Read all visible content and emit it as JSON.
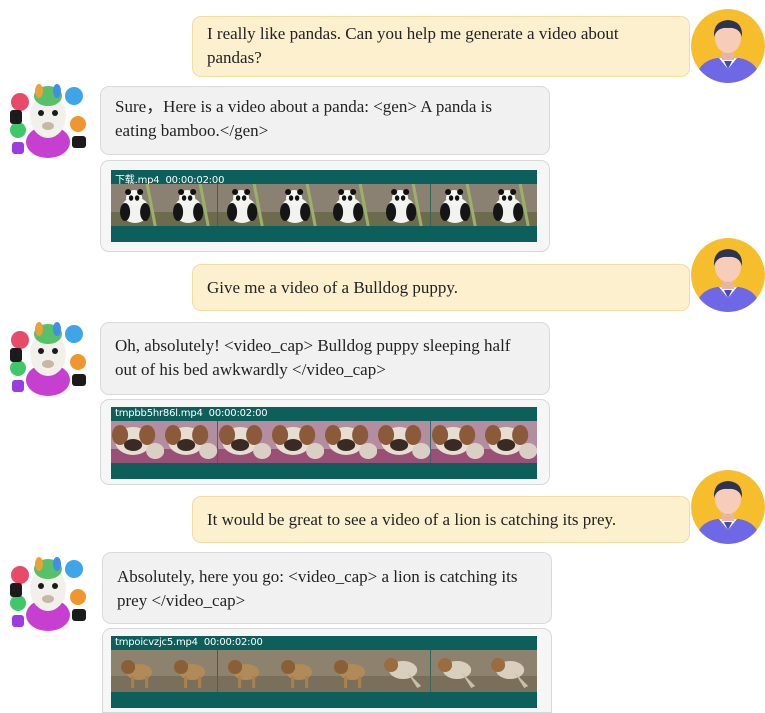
{
  "conversation": [
    {
      "role": "user",
      "text": "I really like pandas. Can you help me generate a video about pandas?"
    },
    {
      "role": "assistant",
      "text": "Sure，Here is  a video about a panda: <gen> A panda is eating bamboo.</gen>",
      "video": {
        "filename": "下载.mp4",
        "timestamp": "00:00:02:00",
        "subject": "panda"
      }
    },
    {
      "role": "user",
      "text": "Give me a video of a Bulldog puppy."
    },
    {
      "role": "assistant",
      "text": "Oh, absolutely!  <video_cap> Bulldog puppy sleeping half out of his bed awkwardly </video_cap>",
      "video": {
        "filename": "tmpbb5hr86l.mp4",
        "timestamp": "00:00:02:00",
        "subject": "bulldog puppy"
      }
    },
    {
      "role": "user",
      "text": "It would be great to see a video of a lion is catching its prey."
    },
    {
      "role": "assistant",
      "text": "Absolutely, here you go: <video_cap> a lion is catching its prey </video_cap>",
      "video": {
        "filename": "tmpoicvzjc5.mp4",
        "timestamp": "00:00:02:00",
        "subject": "lion"
      }
    }
  ],
  "icons": {
    "user_avatar": "user-avatar-icon",
    "assistant_avatar": "rainbow-alpaca-icon"
  },
  "colors": {
    "user_bubble": "#fcf0cf",
    "user_border": "#f3dc9f",
    "assistant_bubble": "#f1f1f1",
    "assistant_border": "#dadada",
    "video_strip": "#0c5f5a",
    "avatar_bg": "#f6be2c",
    "avatar_shirt": "#6e68e6"
  }
}
